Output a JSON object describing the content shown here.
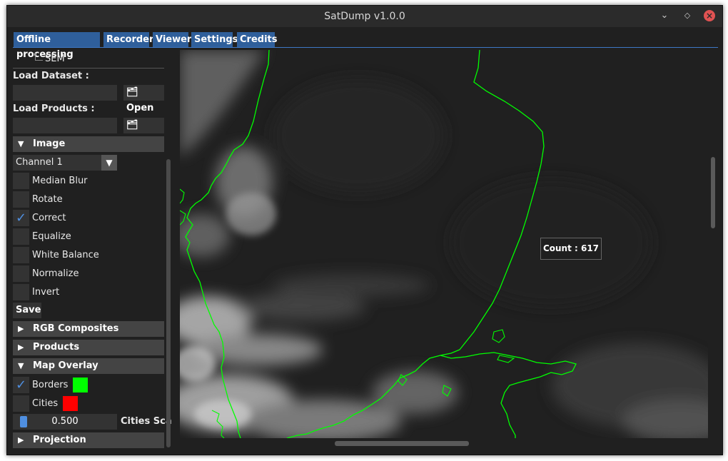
{
  "window": {
    "title": "SatDump v1.0.0"
  },
  "tabs": [
    {
      "label": "Offline processing"
    },
    {
      "label": "Recorder"
    },
    {
      "label": "Viewer"
    },
    {
      "label": "Settings"
    },
    {
      "label": "Credits"
    }
  ],
  "sidebar": {
    "tree_item": "SEM",
    "load_dataset_label": "Load Dataset :",
    "load_products_label": "Load Products :",
    "open_label": "Open",
    "image_header": "Image",
    "channel_select": "Channel 1",
    "options": [
      {
        "label": "Median Blur",
        "checked": false
      },
      {
        "label": "Rotate",
        "checked": false
      },
      {
        "label": "Correct",
        "checked": true
      },
      {
        "label": "Equalize",
        "checked": false
      },
      {
        "label": "White Balance",
        "checked": false
      },
      {
        "label": "Normalize",
        "checked": false
      },
      {
        "label": "Invert",
        "checked": false
      }
    ],
    "save_label": "Save",
    "rgb_header": "RGB Composites",
    "products_header": "Products",
    "map_overlay_header": "Map Overlay",
    "borders_label": "Borders",
    "borders_checked": true,
    "borders_color": "#00ff00",
    "cities_label": "Cities",
    "cities_checked": false,
    "cities_color": "#ff0000",
    "cities_scale_value": "0.500",
    "cities_scale_label": "Cities Sca",
    "projection_header": "Projection"
  },
  "viewer": {
    "tooltip": "Count : 617",
    "border_color": "#00ff00"
  },
  "colors": {
    "accent": "#2f5f9b",
    "check": "#4f8fe0"
  }
}
